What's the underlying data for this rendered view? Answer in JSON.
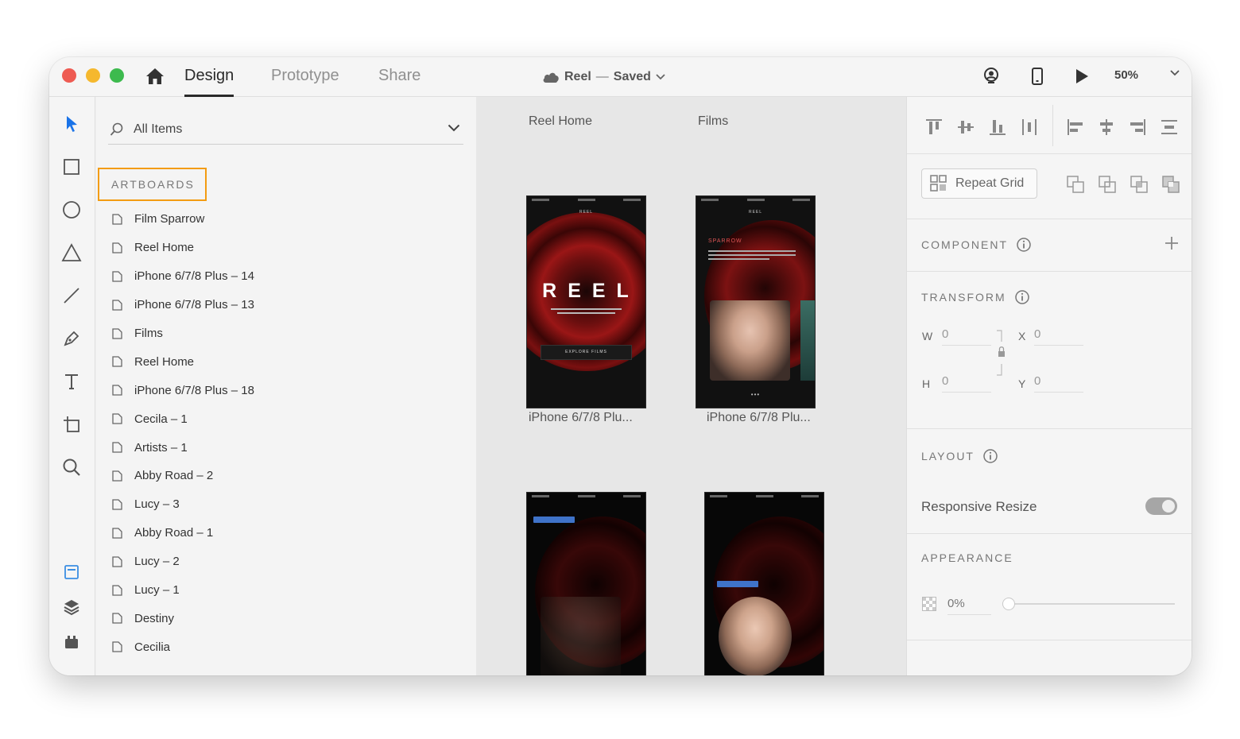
{
  "titlebar": {
    "tabs": [
      {
        "label": "Design"
      },
      {
        "label": "Prototype"
      },
      {
        "label": "Share"
      }
    ],
    "document_name": "Reel",
    "separator": "—",
    "save_status": "Saved",
    "zoom": "50%"
  },
  "layers": {
    "filter_label": "All Items",
    "section_title": "ARTBOARDS",
    "items": [
      {
        "label": "Film Sparrow"
      },
      {
        "label": "Reel Home"
      },
      {
        "label": "iPhone 6/7/8 Plus – 14"
      },
      {
        "label": "iPhone 6/7/8 Plus – 13"
      },
      {
        "label": "Films"
      },
      {
        "label": "Reel Home"
      },
      {
        "label": "iPhone 6/7/8 Plus – 18"
      },
      {
        "label": "Cecila – 1"
      },
      {
        "label": "Artists – 1"
      },
      {
        "label": "Abby Road – 2"
      },
      {
        "label": "Lucy – 3"
      },
      {
        "label": "Abby Road – 1"
      },
      {
        "label": "Lucy – 2"
      },
      {
        "label": "Lucy – 1"
      },
      {
        "label": "Destiny"
      },
      {
        "label": "Cecilia"
      }
    ]
  },
  "canvas": {
    "artboards": [
      {
        "label": "Reel Home",
        "headline": "REEL",
        "button": "EXPLORE FILMS",
        "logo": "REEL"
      },
      {
        "label": "Films",
        "title": "SPARROW",
        "logo": "REEL"
      },
      {
        "label": "iPhone 6/7/8 Plu..."
      },
      {
        "label": "iPhone 6/7/8 Plu..."
      }
    ]
  },
  "inspector": {
    "repeat_grid_label": "Repeat Grid",
    "component_title": "COMPONENT",
    "transform_title": "TRANSFORM",
    "fields": {
      "w_label": "W",
      "w_value": "0",
      "h_label": "H",
      "h_value": "0",
      "x_label": "X",
      "x_value": "0",
      "y_label": "Y",
      "y_value": "0"
    },
    "layout_title": "LAYOUT",
    "responsive_resize_label": "Responsive Resize",
    "responsive_resize_on": true,
    "appearance_title": "APPEARANCE",
    "opacity_value": "0%",
    "opacity_fraction": 0
  },
  "colors": {
    "highlight_border": "#f39c12",
    "tool_active": "#1a73e8",
    "blue_button": "#3f73c9",
    "close": "#ee5b52",
    "minimize": "#f5b82e",
    "maximize": "#3dba4e"
  }
}
